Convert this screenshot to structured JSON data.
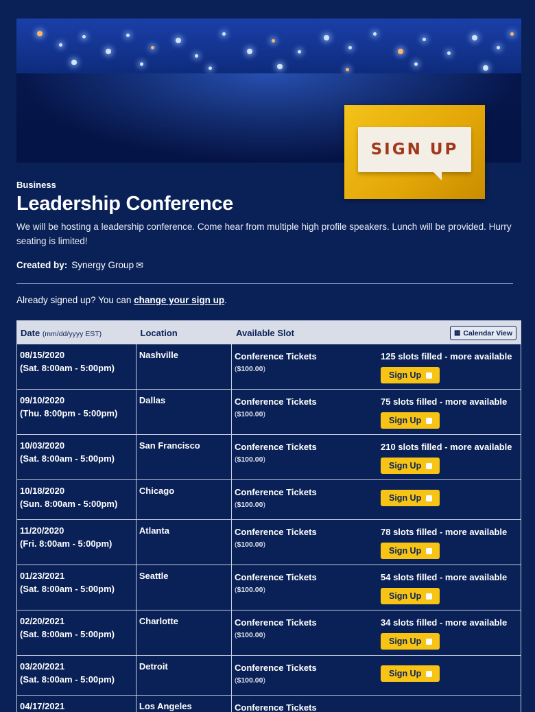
{
  "banner": {
    "signup_text": "SIGN UP"
  },
  "event": {
    "category": "Business",
    "title": "Leadership Conference",
    "description": "We will be hosting a leadership conference.  Come hear from multiple high profile speakers.  Lunch will be provided. Hurry seating is limited!",
    "created_by_label": "Created by:",
    "created_by_name": "Synergy Group"
  },
  "signed_up": {
    "prefix": "Already signed up? You can ",
    "link": "change your sign up",
    "suffix": "."
  },
  "table": {
    "headers": {
      "date": "Date",
      "date_hint": "(mm/dd/yyyy EST)",
      "location": "Location",
      "slot": "Available Slot",
      "calendar_view": "Calendar View"
    },
    "rows": [
      {
        "date": "08/15/2020",
        "time": "(Sat. 8:00am - 5:00pm)",
        "location": "Nashville",
        "slot": "Conference Tickets",
        "price_open": "(",
        "price": "$100.00",
        "price_close": ")",
        "status": "125 slots filled - more available",
        "button": "Sign Up"
      },
      {
        "date": "09/10/2020",
        "time": "(Thu. 8:00pm - 5:00pm)",
        "location": "Dallas",
        "slot": "Conference Tickets",
        "price_open": "(",
        "price": "$100.00",
        "price_close": ")",
        "status": "75 slots filled - more available",
        "button": "Sign Up"
      },
      {
        "date": "10/03/2020",
        "time": "(Sat. 8:00am - 5:00pm)",
        "location": "San Francisco",
        "slot": "Conference Tickets",
        "price_open": "(",
        "price": "$100.00",
        "price_close": ")",
        "status": "210 slots filled - more available",
        "button": "Sign Up"
      },
      {
        "date": "10/18/2020",
        "time": "(Sun. 8:00am - 5:00pm)",
        "location": "Chicago",
        "slot": "Conference Tickets",
        "price_open": "(",
        "price": "$100.00",
        "price_close": ")",
        "status": "",
        "button": "Sign Up"
      },
      {
        "date": "11/20/2020",
        "time": "(Fri. 8:00am - 5:00pm)",
        "location": "Atlanta",
        "slot": "Conference Tickets",
        "price_open": "(",
        "price": "$100.00",
        "price_close": ")",
        "status": "78 slots filled - more available",
        "button": "Sign Up"
      },
      {
        "date": "01/23/2021",
        "time": "(Sat. 8:00am - 5:00pm)",
        "location": "Seattle",
        "slot": "Conference Tickets",
        "price_open": "(",
        "price": "$100.00",
        "price_close": ")",
        "status": "54 slots filled - more available",
        "button": "Sign Up"
      },
      {
        "date": "02/20/2021",
        "time": "(Sat. 8:00am - 5:00pm)",
        "location": "Charlotte",
        "slot": "Conference Tickets",
        "price_open": "(",
        "price": "$100.00",
        "price_close": ")",
        "status": "34 slots filled - more available",
        "button": "Sign Up"
      },
      {
        "date": "03/20/2021",
        "time": "(Sat. 8:00am - 5:00pm)",
        "location": "Detroit",
        "slot": "Conference Tickets",
        "price_open": "(",
        "price": "$100.00",
        "price_close": ")",
        "status": "",
        "button": "Sign Up"
      },
      {
        "date": "04/17/2021",
        "time": "",
        "location": "Los Angeles",
        "slot": "Conference Tickets",
        "price_open": "",
        "price": "",
        "price_close": "",
        "status": "",
        "button": ""
      }
    ]
  }
}
